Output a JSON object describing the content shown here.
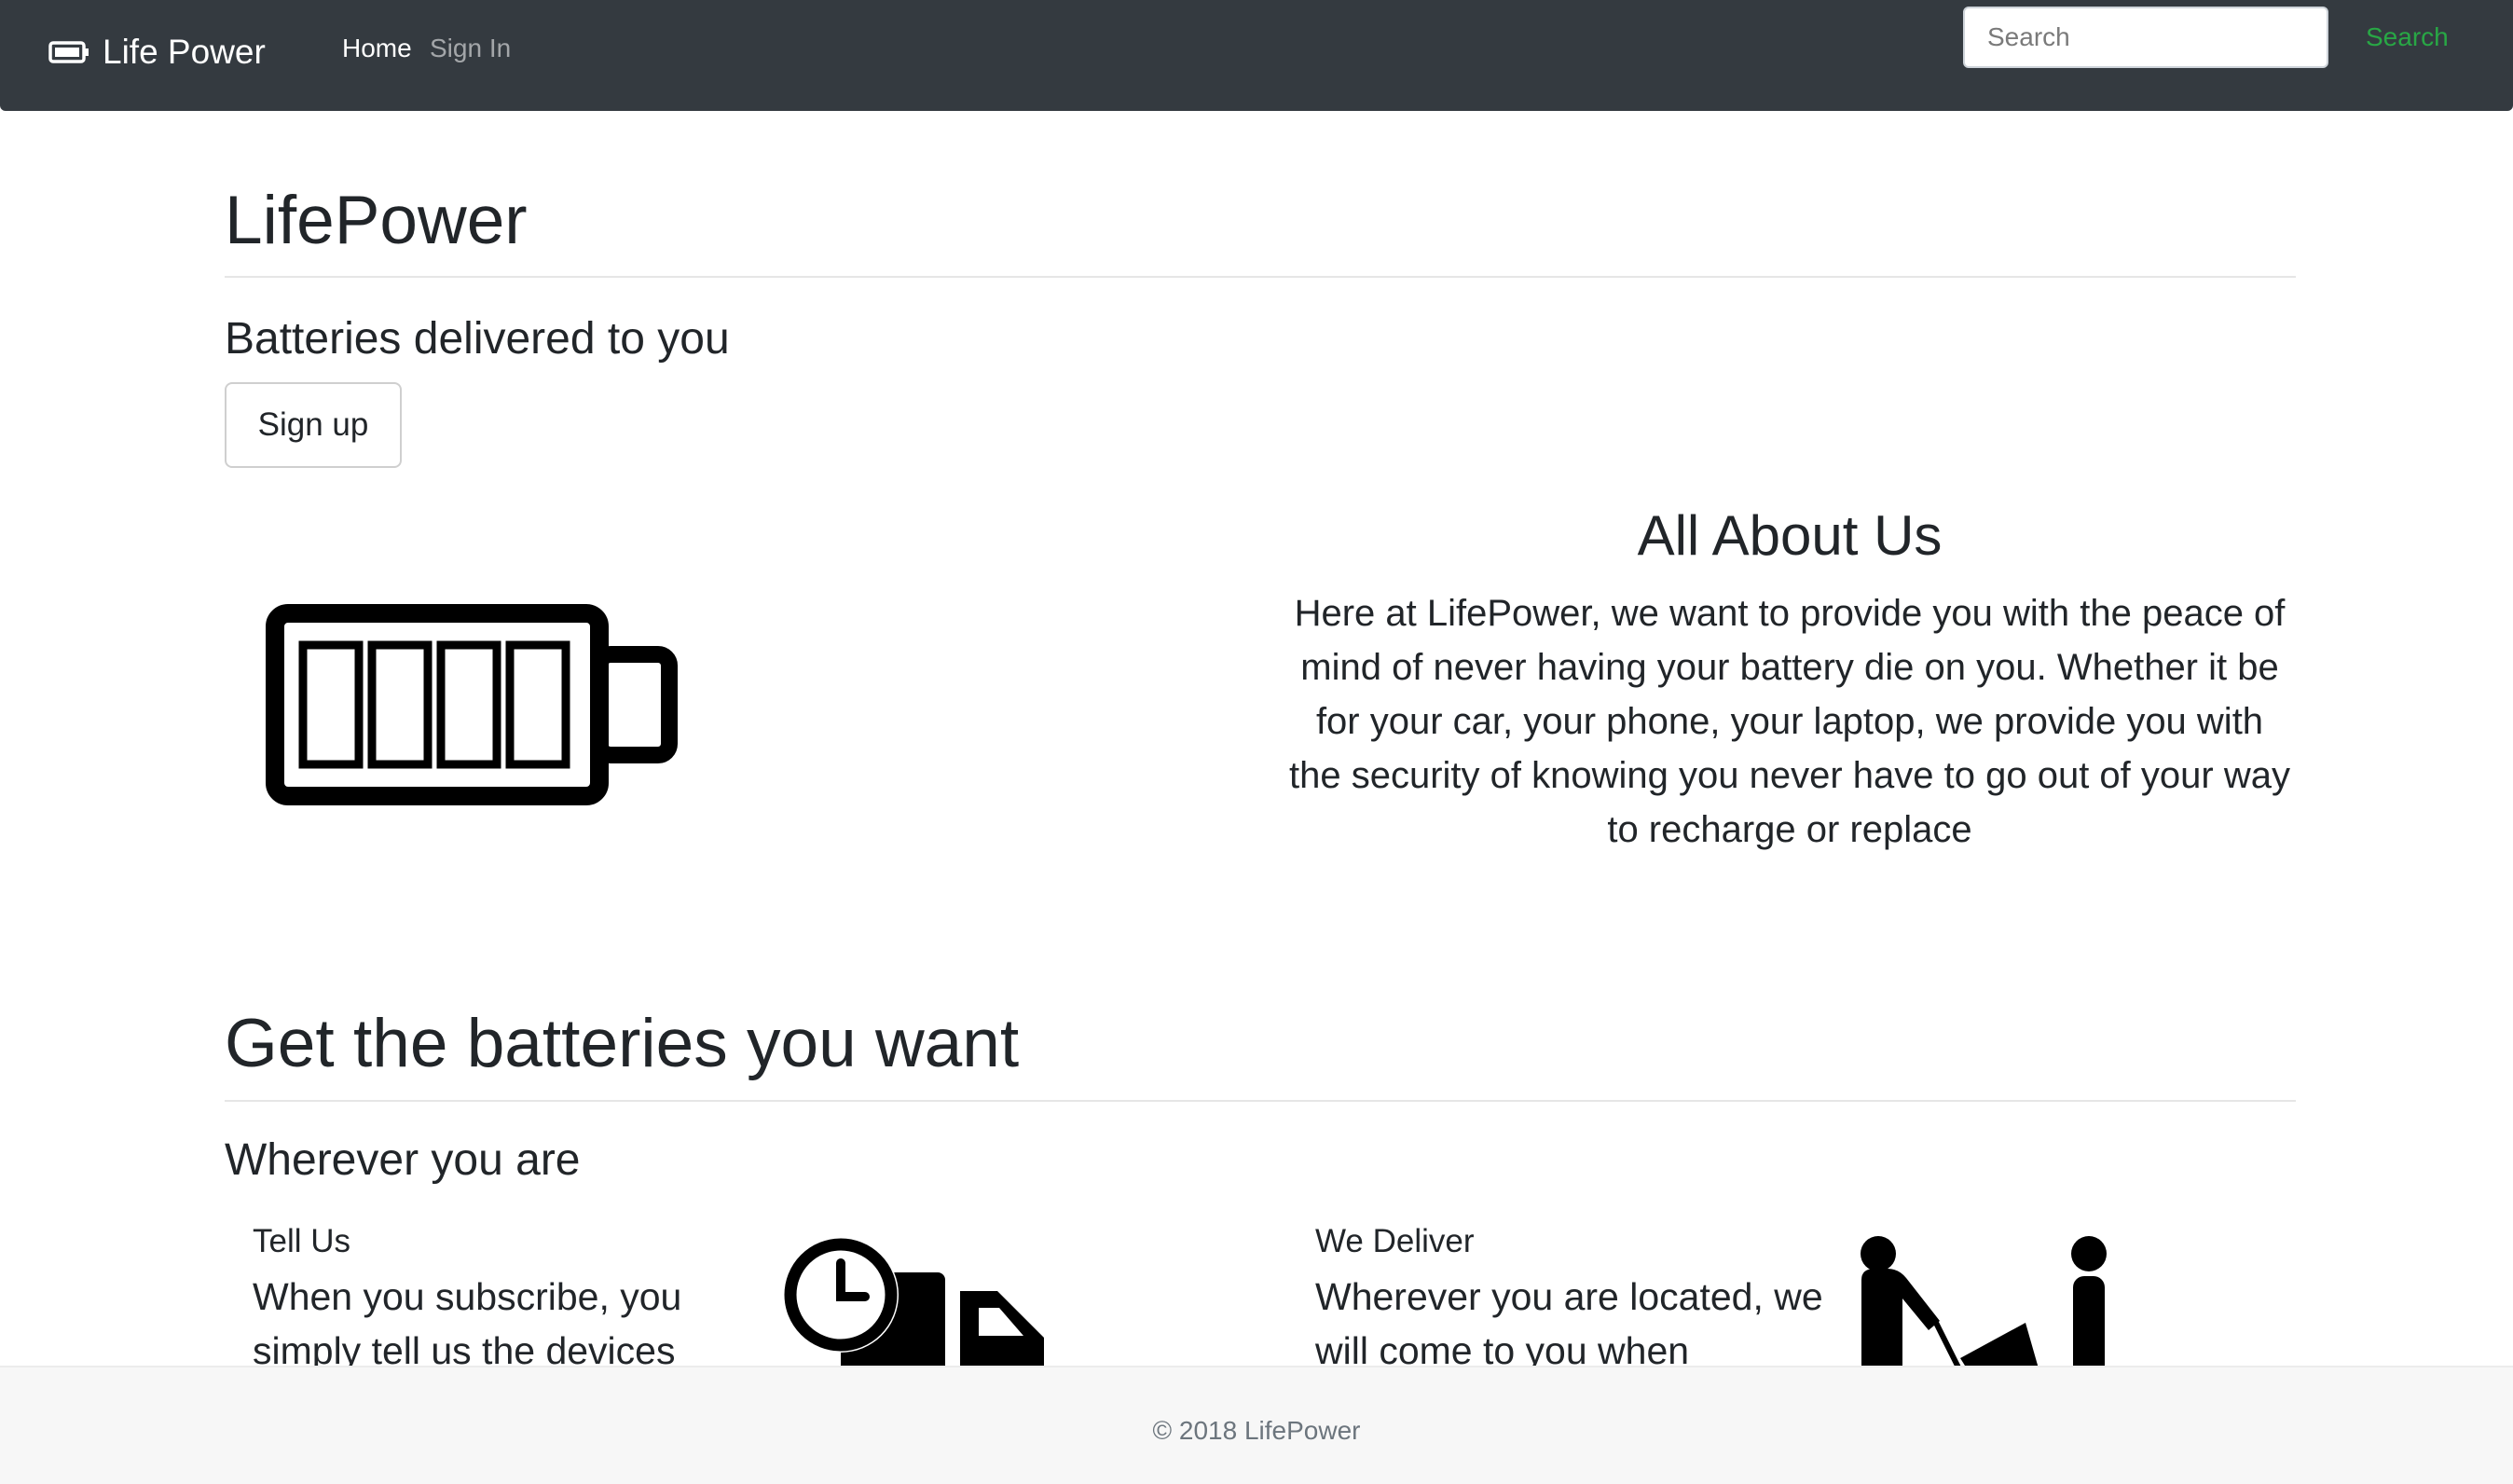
{
  "navbar": {
    "brand": "Life Power",
    "brand_icon": "battery-icon",
    "links": [
      {
        "label": "Home",
        "active": true
      },
      {
        "label": "Sign In",
        "active": false
      }
    ],
    "search": {
      "placeholder": "Search",
      "value": "",
      "button_label": "Search",
      "button_color": "#28a745"
    },
    "background": "#343a40"
  },
  "hero": {
    "title": "LifePower",
    "tagline": "Batteries delivered to you",
    "signup_label": "Sign up",
    "image_icon": "battery-full-icon"
  },
  "about": {
    "title": "All About Us",
    "text": "Here at LifePower, we want to provide you with the peace of mind of never having your battery die on you. Whether it be for your car, your phone, your laptop, we provide you with the security of knowing you never have to go out of your way to recharge or replace"
  },
  "section": {
    "title": "Get the batteries you want",
    "subtitle": "Wherever you are",
    "cards": [
      {
        "title": "Tell Us",
        "text": "When you subscribe, you simply tell us the devices",
        "icon": "delivery-truck-clock-icon"
      },
      {
        "title": "We Deliver",
        "text": "Wherever you are located, we will come to you when",
        "icon": "delivery-person-icon"
      }
    ]
  },
  "footer": {
    "text": "© 2018 LifePower"
  }
}
